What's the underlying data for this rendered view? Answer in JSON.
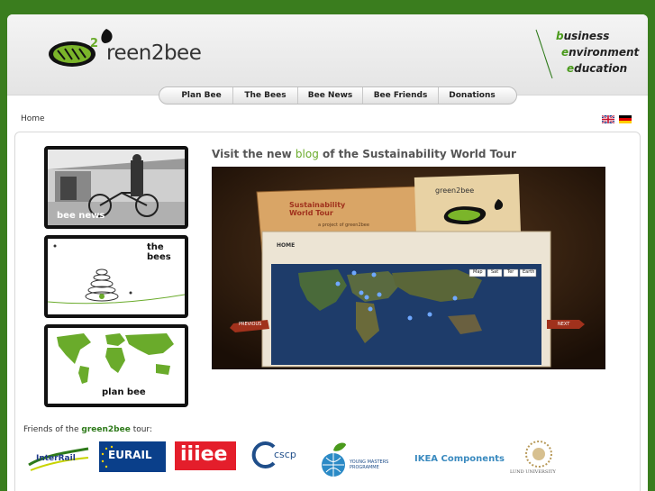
{
  "header": {
    "logo_text": "reen2bee",
    "tagline": [
      {
        "first": "b",
        "rest": "usiness"
      },
      {
        "first": "e",
        "rest": "nvironment"
      },
      {
        "first": "e",
        "rest": "ducation"
      }
    ]
  },
  "nav": {
    "items": [
      "Plan Bee",
      "The Bees",
      "Bee News",
      "Bee Friends",
      "Donations"
    ]
  },
  "breadcrumb": "Home",
  "sidebar": {
    "bee_news": "bee news",
    "the_bees": "the bees",
    "plan_bee": "plan bee"
  },
  "feature": {
    "headline_before": "Visit the new ",
    "headline_link": "blog",
    "headline_after": " of the Sustainability World Tour",
    "sign_title": "Sustainability World Tour",
    "sign_sub": "a project of green2bee",
    "badge_text": "green2bee",
    "home_label": "HOME",
    "map_buttons": [
      "Map",
      "Sat",
      "Ter",
      "Earth"
    ],
    "previous": "PREVIOUS",
    "next": "NEXT"
  },
  "friends": {
    "prefix": "Friends of the ",
    "brand": "green2bee",
    "suffix": " tour:"
  },
  "partners": {
    "interrail": "InterRail",
    "eurail": "EURAIL",
    "iiiee": "iiiee",
    "cscp": "cscp",
    "ymp": "YOUNG MASTERS PROGRAMME",
    "ikea": "IKEA Components",
    "lund": "LUND UNIVERSITY"
  },
  "colors": {
    "background": "#3a7d1e",
    "accent": "#6aab2b",
    "nav_text": "#222222"
  }
}
